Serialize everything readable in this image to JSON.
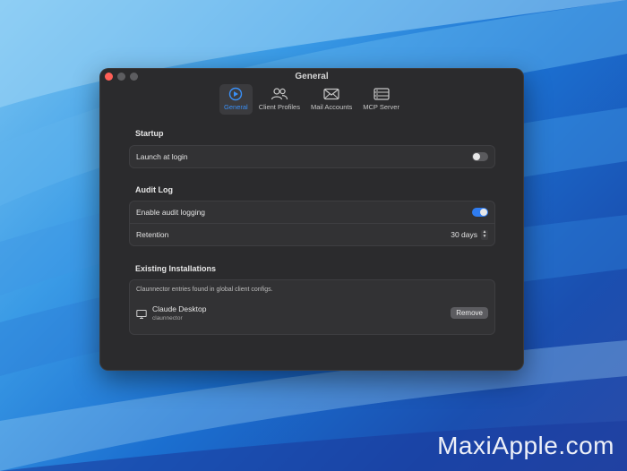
{
  "window": {
    "title": "General"
  },
  "tabs": [
    {
      "label": "General",
      "icon": "gauge-icon",
      "active": true
    },
    {
      "label": "Client Profiles",
      "icon": "people-icon",
      "active": false
    },
    {
      "label": "Mail Accounts",
      "icon": "envelope-icon",
      "active": false
    },
    {
      "label": "MCP Server",
      "icon": "server-icon",
      "active": false
    }
  ],
  "startup": {
    "title": "Startup",
    "launch_at_login_label": "Launch at login",
    "launch_at_login_on": false
  },
  "audit_log": {
    "title": "Audit Log",
    "enable_label": "Enable audit logging",
    "enable_on": true,
    "retention_label": "Retention",
    "retention_value": "30 days"
  },
  "installations": {
    "title": "Existing Installations",
    "caption": "Claunnector entries found in global client configs.",
    "items": [
      {
        "name": "Claude Desktop",
        "sub": "claunnector",
        "action": "Remove"
      }
    ]
  },
  "watermark": "MaxiApple.com",
  "colors": {
    "accent": "#2f7cf0",
    "close": "#ff5f57",
    "window_bg": "#2b2b2d"
  }
}
